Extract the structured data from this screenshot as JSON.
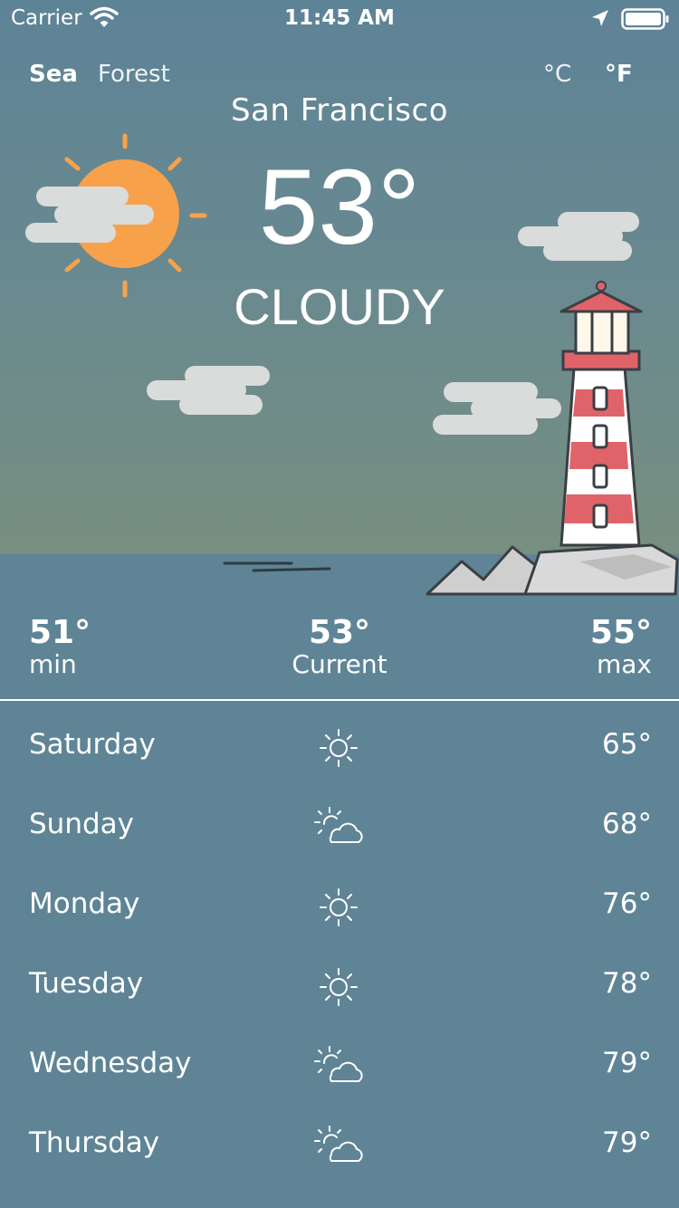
{
  "status_bar": {
    "carrier": "Carrier",
    "time": "11:45 AM",
    "wifi_icon": "wifi-icon",
    "location_icon": "location-arrow-icon",
    "battery_icon": "battery-icon"
  },
  "header": {
    "env_tabs": [
      "Sea",
      "Forest"
    ],
    "selected_env": "Sea",
    "units": [
      "°C",
      "°F"
    ],
    "selected_unit": "°F"
  },
  "city": "San Francisco",
  "current": {
    "temperature": "53°",
    "condition": "CLOUDY"
  },
  "stats": {
    "min": {
      "value": "51°",
      "label": "min"
    },
    "current": {
      "value": "53°",
      "label": "Current"
    },
    "max": {
      "value": "55°",
      "label": "max"
    }
  },
  "forecast": [
    {
      "day": "Saturday",
      "icon": "sun-icon",
      "temp": "65°"
    },
    {
      "day": "Sunday",
      "icon": "partly-cloudy-icon",
      "temp": "68°"
    },
    {
      "day": "Monday",
      "icon": "sun-icon",
      "temp": "76°"
    },
    {
      "day": "Tuesday",
      "icon": "sun-icon",
      "temp": "78°"
    },
    {
      "day": "Wednesday",
      "icon": "partly-cloudy-icon",
      "temp": "79°"
    },
    {
      "day": "Thursday",
      "icon": "partly-cloudy-icon",
      "temp": "79°"
    }
  ],
  "colors": {
    "sky_top": "#5d8397",
    "sky_bottom": "#778f7f",
    "sea": "#5f8496",
    "sun": "#f7a24a",
    "lighthouse_red": "#e0636a"
  }
}
